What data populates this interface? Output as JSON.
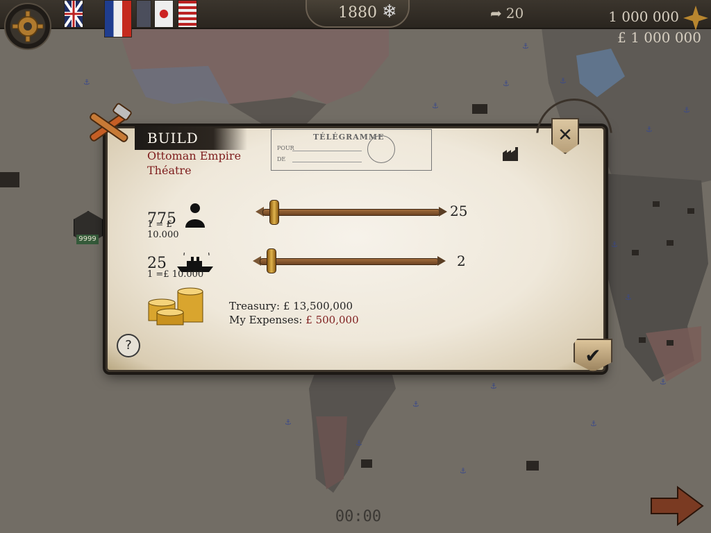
{
  "top_bar": {
    "year": "1880",
    "turns_remaining": "20",
    "money_primary": "1 000 000",
    "money_secondary": "£ 1 000 000",
    "flags": [
      "united-kingdom",
      "france",
      "generic-1",
      "japan",
      "usa"
    ]
  },
  "side": {
    "army_count": "9999"
  },
  "dialog": {
    "title": "BUILD",
    "nation": "Ottoman Empire",
    "theatre": "Théatre",
    "telegram": {
      "heading": "TÉLÉGRAMME",
      "line1": "POUR",
      "line2": "DE"
    },
    "infantry": {
      "count": "775",
      "price": "1 = £ 10.000",
      "slider_max": "25",
      "slider_value_fraction": 0.05
    },
    "navy": {
      "count": "25",
      "price": "1 =£ 10.000",
      "slider_max": "2",
      "slider_value_fraction": 0.05
    },
    "treasury_label": "Treasury:",
    "treasury_value": "£ 13,500,000",
    "expenses_label": "My Expenses:",
    "expenses_value": "£ 500,000",
    "help_label": "?",
    "close_label": "✕",
    "confirm_label": "✔"
  },
  "footer": {
    "timer": "00:00"
  },
  "colors": {
    "accent_red": "#7e1d1d",
    "gold": "#c99a35",
    "map_ocean": "#6f6a62"
  }
}
